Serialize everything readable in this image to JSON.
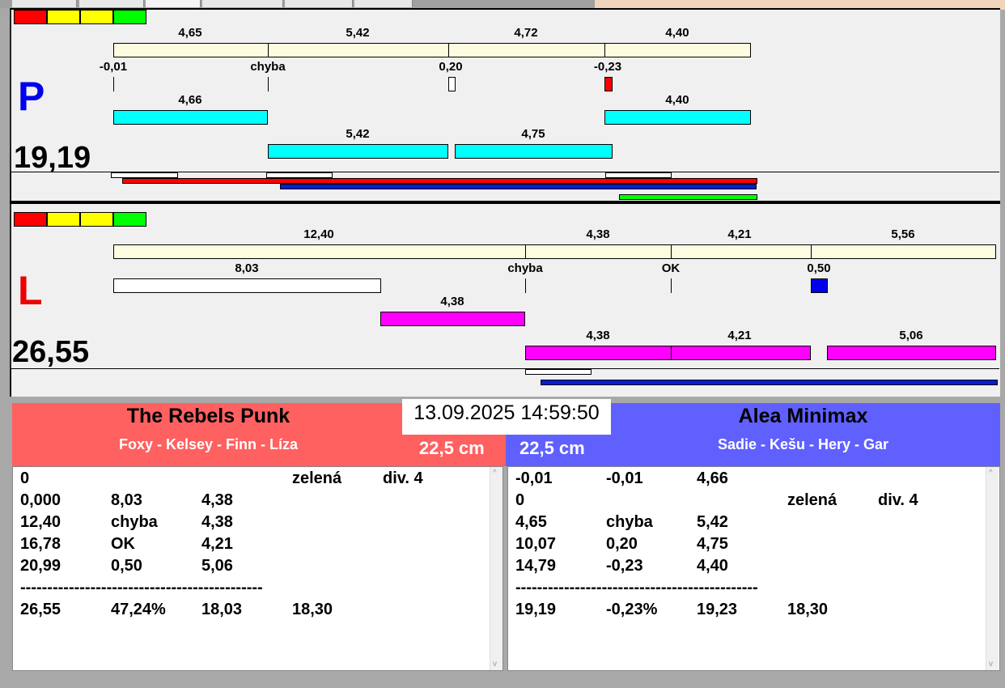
{
  "top": {
    "letter": "P",
    "total": "19,19",
    "row1_labels": [
      "4,65",
      "5,42",
      "4,72",
      "4,40"
    ],
    "row2_labels": [
      "-0,01",
      "chyba",
      "0,20",
      "-0,23"
    ],
    "row3_labels": [
      "4,66",
      "4,40"
    ],
    "row4_labels": [
      "5,42",
      "4,75"
    ]
  },
  "bottom_track": {
    "letter": "L",
    "total": "26,55",
    "row1_labels": [
      "12,40",
      "4,38",
      "4,21",
      "5,56"
    ],
    "row2_labels": [
      "8,03",
      "chyba",
      "OK",
      "0,50"
    ],
    "row3_labels": [
      "4,38"
    ],
    "row4_labels": [
      "4,38",
      "4,21",
      "5,06"
    ]
  },
  "colors": {
    "red": "#ff6060",
    "blue": "#6060ff",
    "cyan": "#00ffff",
    "magenta": "#ff00ff"
  },
  "datetime": "13.09.2025 14:59:50",
  "left_team": {
    "name": "The Rebels Punk",
    "members": "Foxy - Kelsey - Finn - Líza",
    "height": "22,5 cm",
    "rows": [
      [
        "0",
        "",
        "",
        "zelená",
        "div. 4"
      ],
      [
        "0,000",
        "8,03",
        "4,38",
        "",
        ""
      ],
      [
        "12,40",
        "chyba",
        "4,38",
        "",
        ""
      ],
      [
        "16,78",
        "OK",
        "4,21",
        "",
        ""
      ],
      [
        "20,99",
        "0,50",
        "5,06",
        "",
        ""
      ],
      [
        "---------------------------------------------",
        "",
        "",
        "",
        ""
      ],
      [
        "26,55",
        "47,24%",
        "18,03",
        "18,30",
        ""
      ]
    ]
  },
  "right_team": {
    "name": "Alea Minimax",
    "members": "Sadie - Kešu - Hery - Gar",
    "height": "22,5 cm",
    "rows": [
      [
        "-0,01",
        "-0,01",
        "4,66",
        "",
        ""
      ],
      [
        "0",
        "",
        "",
        "zelená",
        "div. 4"
      ],
      [
        "4,65",
        "chyba",
        "5,42",
        "",
        ""
      ],
      [
        "10,07",
        "0,20",
        "4,75",
        "",
        ""
      ],
      [
        "14,79",
        "-0,23",
        "4,40",
        "",
        ""
      ],
      [
        "---------------------------------------------",
        "",
        "",
        "",
        ""
      ],
      [
        "19,19",
        "-0,23%",
        "19,23",
        "18,30",
        ""
      ]
    ]
  }
}
